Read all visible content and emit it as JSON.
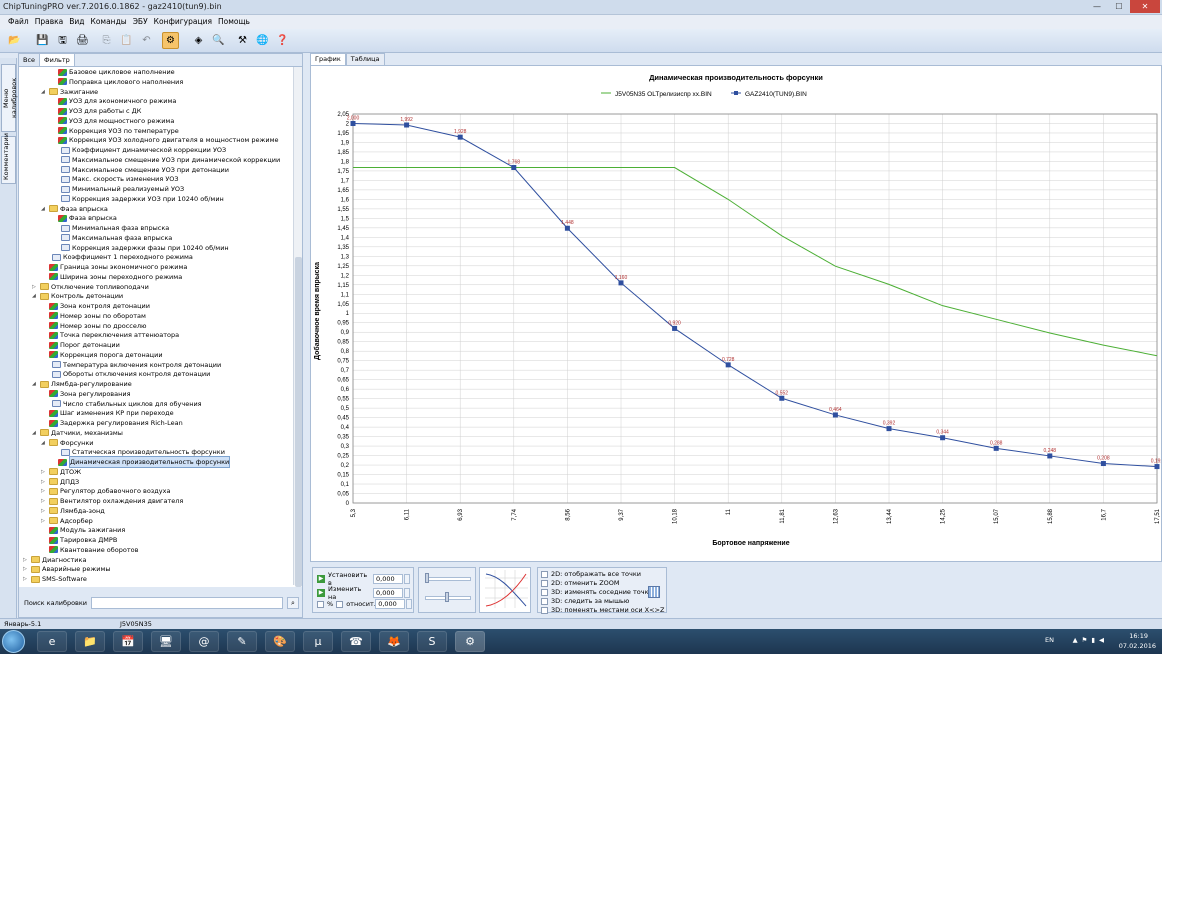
{
  "window": {
    "title": "ChipTuningPRO ver.7.2016.0.1862 - gaz2410(tun9).bin"
  },
  "menu": [
    "Файл",
    "Правка",
    "Вид",
    "Команды",
    "ЭБУ",
    "Конфигурация",
    "Помощь"
  ],
  "side_tabs": [
    "Меню калибровок",
    "Комментарии"
  ],
  "left_tabs": [
    "Все",
    "Фильтр"
  ],
  "tree": [
    {
      "label": "Базовое цикловое наполнение",
      "level": 3,
      "icon": "map"
    },
    {
      "label": "Поправка циклового наполнения",
      "level": 3,
      "icon": "map"
    },
    {
      "label": "Зажигание",
      "level": 2,
      "icon": "folder",
      "expanded": true
    },
    {
      "label": "УОЗ для экономичного режима",
      "level": 3,
      "icon": "map"
    },
    {
      "label": "УОЗ для работы с ДК",
      "level": 3,
      "icon": "map"
    },
    {
      "label": "УОЗ для мощностного режима",
      "level": 3,
      "icon": "map"
    },
    {
      "label": "Коррекция УОЗ по температуре",
      "level": 3,
      "icon": "map"
    },
    {
      "label": "Коррекция УОЗ холодного двигателя в мощностном режиме",
      "level": 3,
      "icon": "map"
    },
    {
      "label": "Коэффициент динамической коррекции УОЗ",
      "level": 3,
      "icon": "num"
    },
    {
      "label": "Максимальное смещение УОЗ при динамической коррекции",
      "level": 3,
      "icon": "num"
    },
    {
      "label": "Максимальное смещение УОЗ при детонации",
      "level": 3,
      "icon": "num"
    },
    {
      "label": "Макс. скорость изменения УОЗ",
      "level": 3,
      "icon": "num"
    },
    {
      "label": "Минимальный реализуемый УОЗ",
      "level": 3,
      "icon": "num"
    },
    {
      "label": "Коррекция задержки УОЗ при 10240 об/мин",
      "level": 3,
      "icon": "num"
    },
    {
      "label": "Фаза впрыска",
      "level": 2,
      "icon": "folder",
      "expanded": true
    },
    {
      "label": "Фаза впрыска",
      "level": 3,
      "icon": "map"
    },
    {
      "label": "Минимальная фаза впрыска",
      "level": 3,
      "icon": "num"
    },
    {
      "label": "Максимальная фаза впрыска",
      "level": 3,
      "icon": "num"
    },
    {
      "label": "Коррекция задержки фазы при 10240 об/мин",
      "level": 3,
      "icon": "num"
    },
    {
      "label": "Коэффициент 1 переходного режима",
      "level": 2,
      "icon": "num"
    },
    {
      "label": "Граница зоны экономичного режима",
      "level": 2,
      "icon": "map"
    },
    {
      "label": "Ширина зоны переходного режима",
      "level": 2,
      "icon": "map"
    },
    {
      "label": "Отключение топливоподачи",
      "level": 1,
      "icon": "folder",
      "expanded": false
    },
    {
      "label": "Контроль детонации",
      "level": 1,
      "icon": "folder",
      "expanded": true
    },
    {
      "label": "Зона контроля детонации",
      "level": 2,
      "icon": "map"
    },
    {
      "label": "Номер зоны по оборотам",
      "level": 2,
      "icon": "map"
    },
    {
      "label": "Номер зоны по дросселю",
      "level": 2,
      "icon": "map"
    },
    {
      "label": "Точка переключения аттенюатора",
      "level": 2,
      "icon": "map"
    },
    {
      "label": "Порог детонации",
      "level": 2,
      "icon": "map"
    },
    {
      "label": "Коррекция порога детонации",
      "level": 2,
      "icon": "map"
    },
    {
      "label": "Температура включения контроля детонации",
      "level": 2,
      "icon": "num"
    },
    {
      "label": "Обороты отключения контроля детонации",
      "level": 2,
      "icon": "num"
    },
    {
      "label": "Лямбда-регулирование",
      "level": 1,
      "icon": "folder",
      "expanded": true
    },
    {
      "label": "Зона регулирования",
      "level": 2,
      "icon": "map"
    },
    {
      "label": "Число стабильных циклов для обучения",
      "level": 2,
      "icon": "num"
    },
    {
      "label": "Шаг изменения КР при переходе",
      "level": 2,
      "icon": "map"
    },
    {
      "label": "Задержка регулирования Rich-Lean",
      "level": 2,
      "icon": "map"
    },
    {
      "label": "Датчики, механизмы",
      "level": 1,
      "icon": "folder",
      "expanded": true
    },
    {
      "label": "Форсунки",
      "level": 2,
      "icon": "folder",
      "expanded": true
    },
    {
      "label": "Статическая производительность форсунки",
      "level": 3,
      "icon": "num"
    },
    {
      "label": "Динамическая производительность форсунки",
      "level": 3,
      "icon": "map",
      "selected": true
    },
    {
      "label": "ДТОЖ",
      "level": 2,
      "icon": "folder",
      "expanded": false
    },
    {
      "label": "ДПДЗ",
      "level": 2,
      "icon": "folder",
      "expanded": false
    },
    {
      "label": "Регулятор добавочного воздуха",
      "level": 2,
      "icon": "folder",
      "expanded": false
    },
    {
      "label": "Вентилятор охлаждения двигателя",
      "level": 2,
      "icon": "folder",
      "expanded": false
    },
    {
      "label": "Лямбда-зонд",
      "level": 2,
      "icon": "folder",
      "expanded": false
    },
    {
      "label": "Адсорбер",
      "level": 2,
      "icon": "folder",
      "expanded": false
    },
    {
      "label": "Модуль зажигания",
      "level": 2,
      "icon": "map"
    },
    {
      "label": "Тарировка ДМРВ",
      "level": 2,
      "icon": "map"
    },
    {
      "label": "Квантование оборотов",
      "level": 2,
      "icon": "map"
    },
    {
      "label": "Диагностика",
      "level": 0,
      "icon": "folder",
      "expanded": false
    },
    {
      "label": "Аварийные режимы",
      "level": 0,
      "icon": "folder",
      "expanded": false
    },
    {
      "label": "SMS-Software",
      "level": 0,
      "icon": "folder",
      "expanded": false
    }
  ],
  "search": {
    "label": "Поиск калибровки",
    "value": ""
  },
  "right_tabs": [
    "График",
    "Таблица"
  ],
  "chart_data": {
    "type": "line",
    "title": "Динамическая производительность форсунки",
    "xlabel": "Бортовое напряжение",
    "ylabel": "Добавочное время впрыска",
    "categories": [
      "5,3",
      "6,11",
      "6,93",
      "7,74",
      "8,56",
      "9,37",
      "10,18",
      "11",
      "11,81",
      "12,63",
      "13,44",
      "14,25",
      "15,07",
      "15,88",
      "16,7",
      "17,51"
    ],
    "ylim": [
      0,
      2.05
    ],
    "ystep": 0.05,
    "grid": true,
    "legend": "top",
    "series": [
      {
        "name": "J5V05N35 OLTрелизиспр xx.BIN",
        "color": "#4caf35",
        "values": [
          1.768,
          1.768,
          1.768,
          1.768,
          1.768,
          1.768,
          1.768,
          1.6,
          1.408,
          1.248,
          1.152,
          1.04,
          0.968,
          0.896,
          0.832,
          0.776
        ]
      },
      {
        "name": "GAZ2410(TUN9).BIN",
        "color": "#2f4f9f",
        "markers": true,
        "values": [
          2.0,
          1.992,
          1.928,
          1.768,
          1.448,
          1.16,
          0.92,
          0.728,
          0.552,
          0.464,
          0.392,
          0.344,
          0.288,
          0.248,
          0.208,
          0.192
        ],
        "labels": [
          "2,000",
          "1,992",
          "1,928",
          "1,768",
          "1,448",
          "1,160",
          "0,920",
          "0,728",
          "0,552",
          "0,464",
          "0,392",
          "0,344",
          "0,288",
          "0,248",
          "0,208",
          "0,192"
        ]
      }
    ]
  },
  "controls": {
    "set_label": "Установить в",
    "set_value": "0,000",
    "change_label": "Изменить на",
    "change_value": "0,000",
    "percent_label": "%",
    "relative_label": "относит.",
    "relative_value": "0,000",
    "options": [
      "2D: отображать все точки",
      "2D: отменить ZOOM",
      "3D: изменять соседние точки",
      "3D: следить за мышью",
      "3D: поменять местами оси X<>Z"
    ]
  },
  "status": {
    "left": "Январь-5.1",
    "center": "J5V05N35"
  },
  "tray": {
    "lang": "EN",
    "time": "16:19",
    "date": "07.02.2016"
  }
}
